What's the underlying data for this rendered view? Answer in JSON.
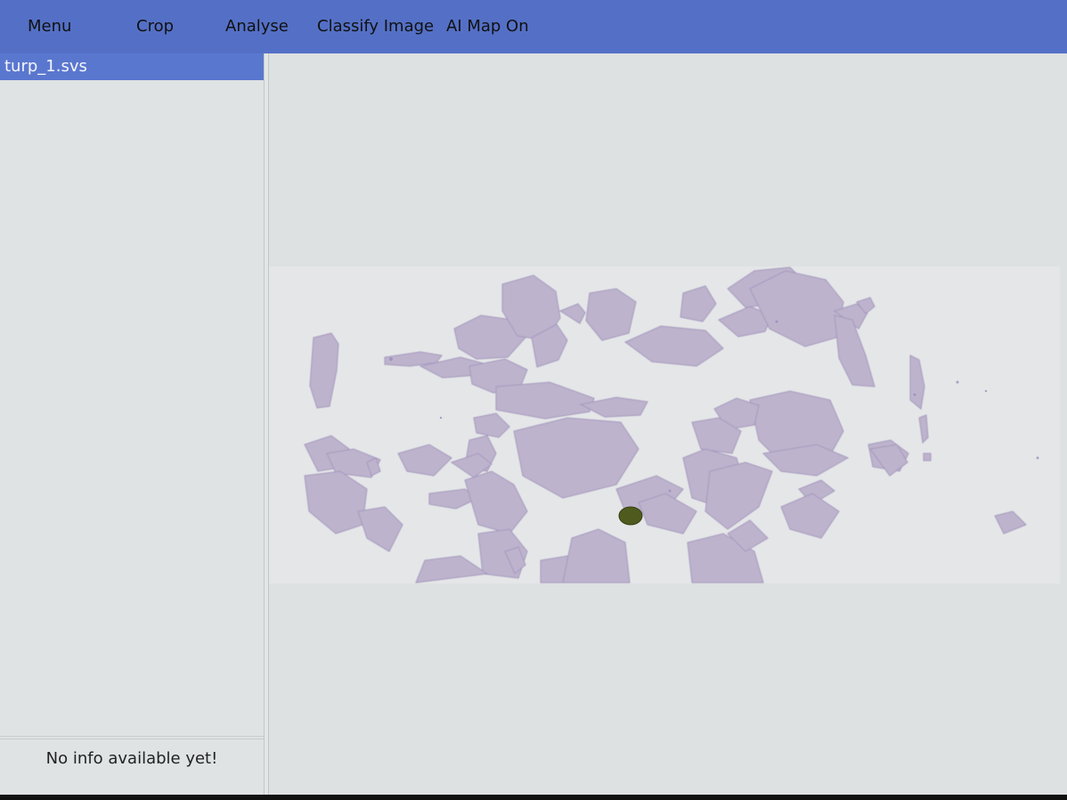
{
  "toolbar": {
    "menu_label": "Menu",
    "crop_label": "Crop",
    "analyse_label": "Analyse",
    "classify_label": "Classify Image",
    "ai_map_label": "AI Map On"
  },
  "sidebar": {
    "files": [
      {
        "name": "turp_1.svs"
      }
    ]
  },
  "info_panel": {
    "message": "No info available yet!"
  },
  "colors": {
    "toolbar_bg": "#5470c6",
    "selected_item_bg": "#5a77cf",
    "panel_bg": "#dfe3e3",
    "tissue": "#b6aac8",
    "marker_ink": "#4f5a1e"
  }
}
